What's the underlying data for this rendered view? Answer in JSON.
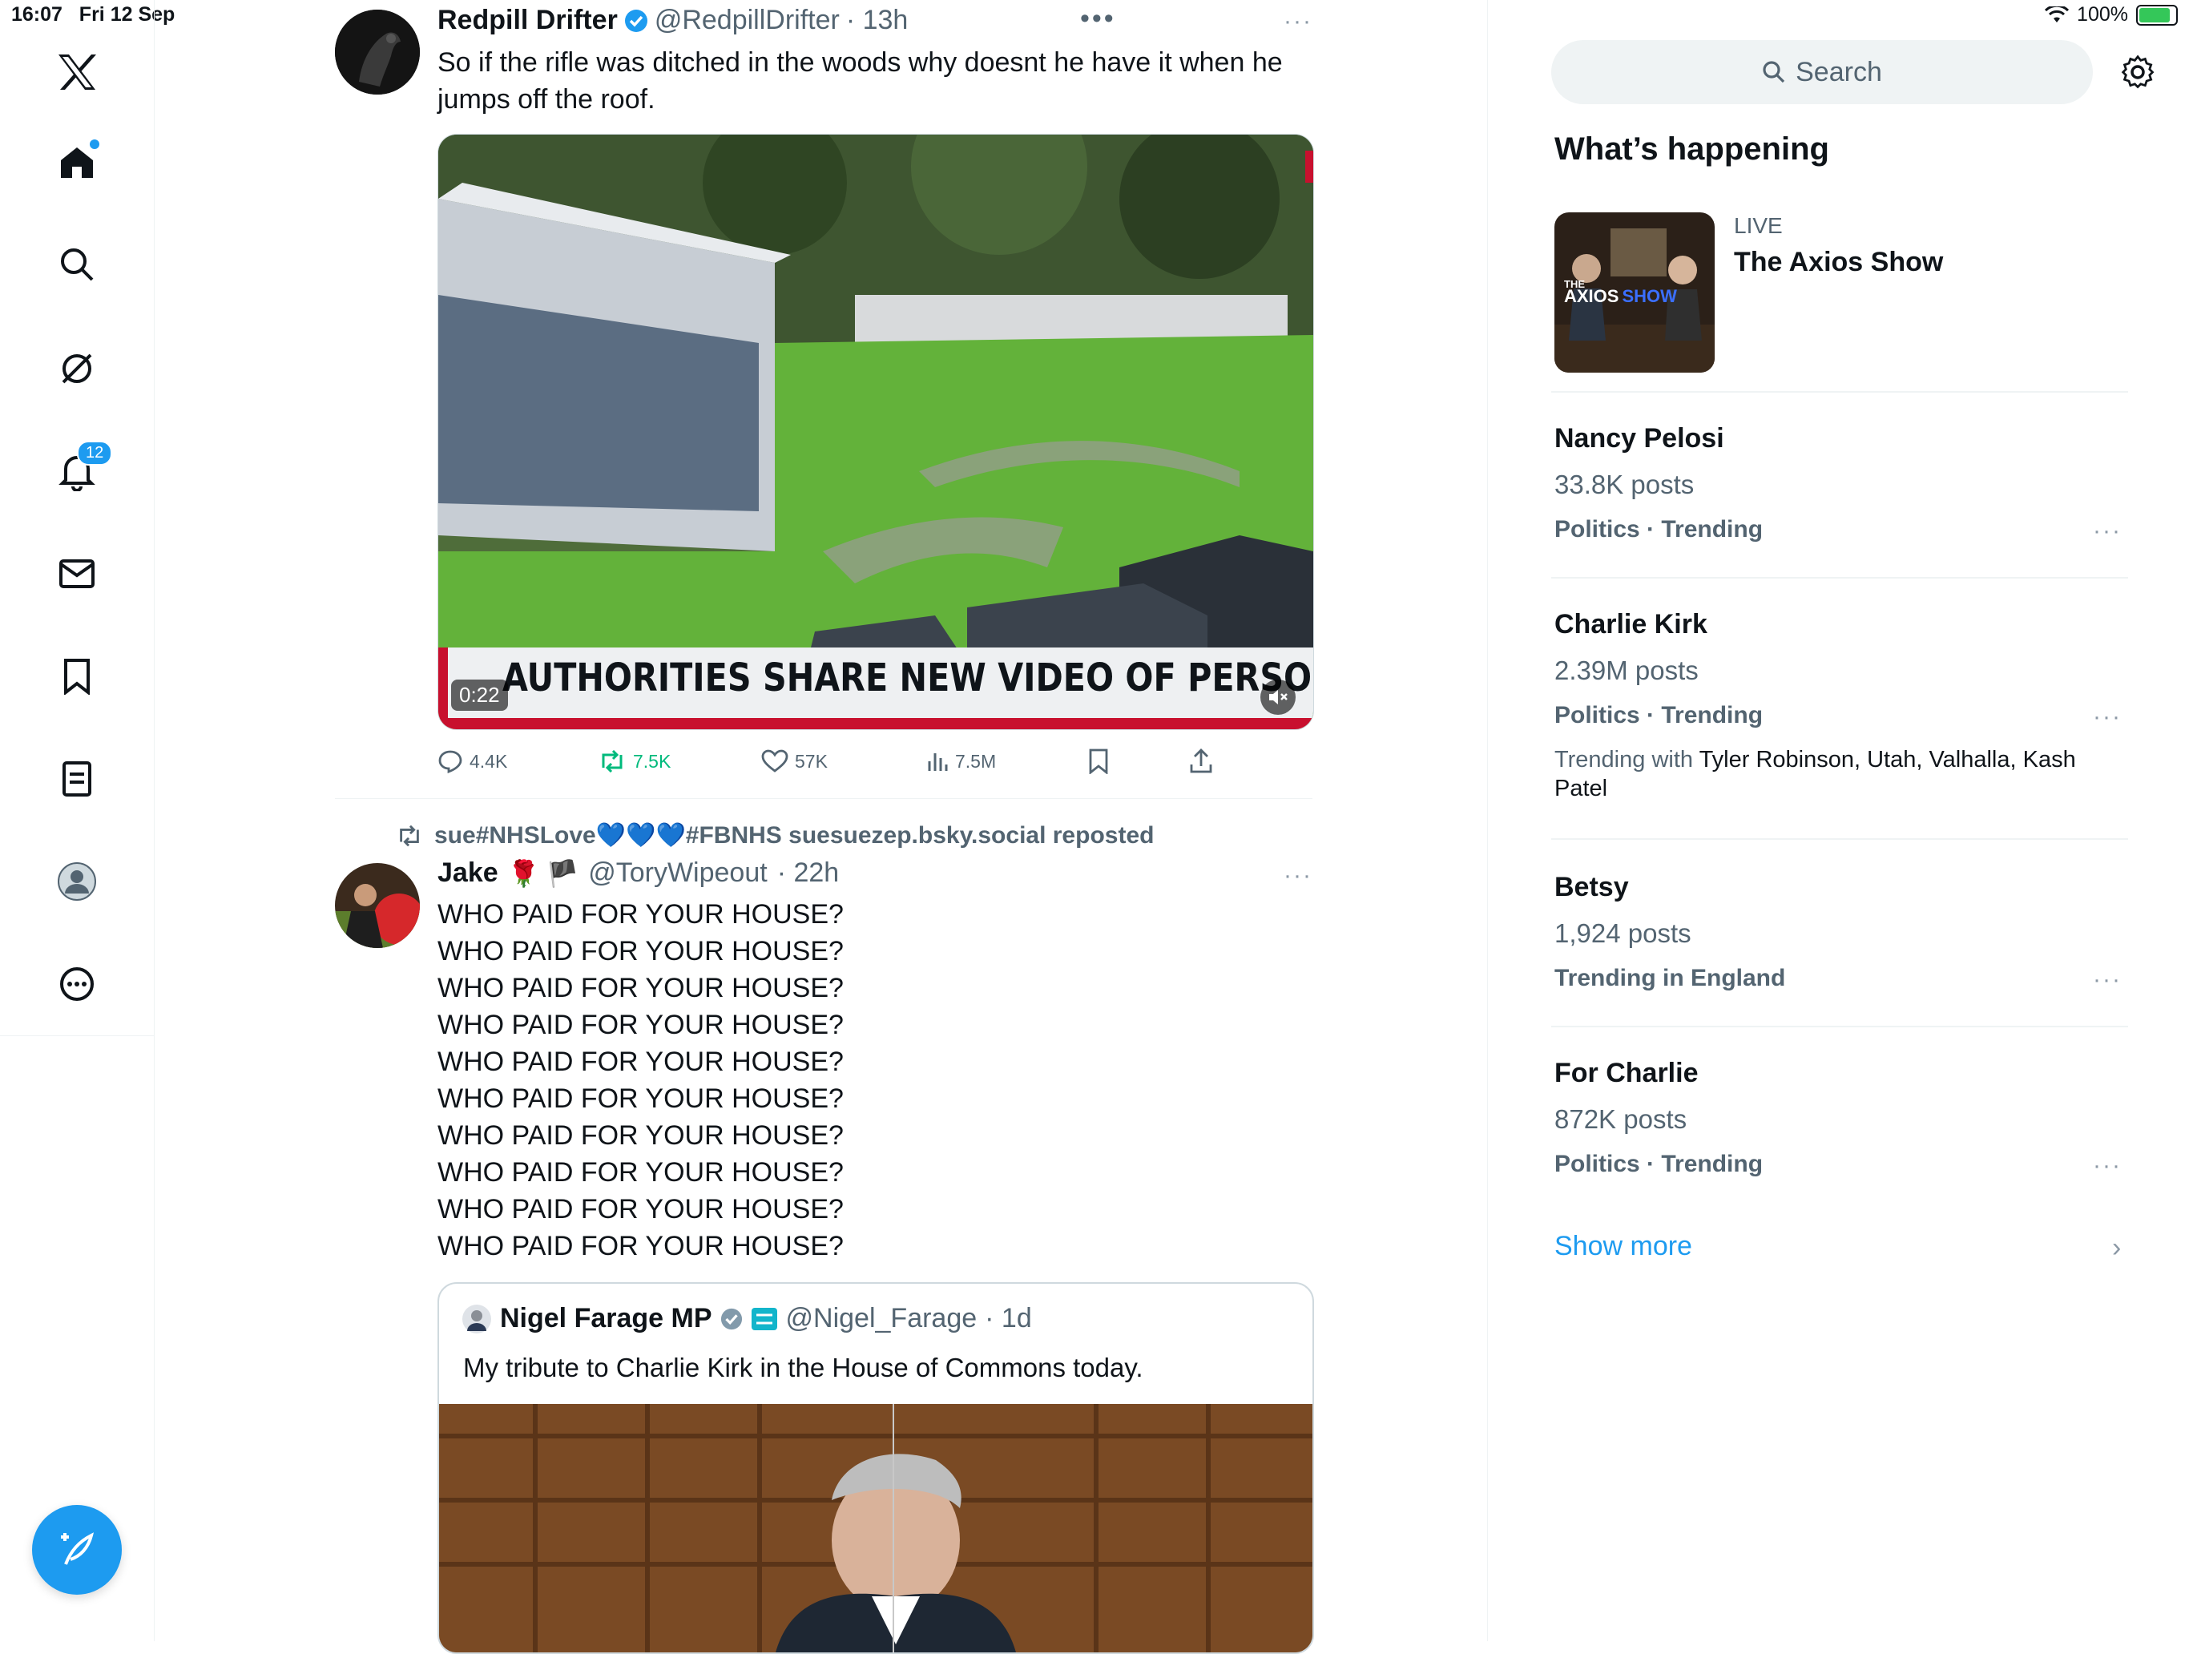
{
  "status_bar": {
    "time": "16:07",
    "date": "Fri 12 Sep",
    "battery": "100%"
  },
  "nav": {
    "notifications_badge": "12"
  },
  "tweets": [
    {
      "name": "Redpill Drifter",
      "handle": "@RedpillDrifter",
      "time": "· 13h",
      "text": "So if the rifle was ditched in the woods why doesnt he have it when he jumps off the roof.",
      "video": {
        "duration": "0:22",
        "caption": "AUTHORITIES SHARE NEW VIDEO OF PERSON OF IN"
      },
      "stats": {
        "replies": "4.4K",
        "reposts": "7.5K",
        "likes": "57K",
        "views": "7.5M"
      }
    },
    {
      "repost_line": "sue#NHSLove💙💙💙#FBNHS suesuezep.bsky.social reposted",
      "name": "Jake",
      "name_emojis": "🌹 🏴",
      "handle": "@ToryWipeout",
      "time": "· 22h",
      "lines": [
        "WHO PAID FOR YOUR HOUSE?",
        "WHO PAID FOR YOUR HOUSE?",
        "WHO PAID FOR YOUR HOUSE?",
        "WHO PAID FOR YOUR HOUSE?",
        "WHO PAID FOR YOUR HOUSE?",
        "WHO PAID FOR YOUR HOUSE?",
        "WHO PAID FOR YOUR HOUSE?",
        "WHO PAID FOR YOUR HOUSE?",
        "WHO PAID FOR YOUR HOUSE?",
        "WHO PAID FOR YOUR HOUSE?"
      ],
      "quote": {
        "name": "Nigel Farage MP",
        "handle": "@Nigel_Farage",
        "time": "· 1d",
        "text": "My tribute to Charlie Kirk in the House of Commons today."
      }
    }
  ],
  "right": {
    "search_placeholder": "Search",
    "section_title": "What’s happening",
    "live": {
      "label": "LIVE",
      "title": "The Axios Show",
      "thumb_logo_small": "THE",
      "thumb_logo": "AXIOS",
      "thumb_logo_accent": "SHOW"
    },
    "trends": [
      {
        "title": "Nancy Pelosi",
        "count": "33.8K posts",
        "category": "Politics · Trending"
      },
      {
        "title": "Charlie Kirk",
        "count": "2.39M posts",
        "category": "Politics · Trending",
        "with_label": "Trending with",
        "with_items": "Tyler Robinson, Utah, Valhalla, Kash",
        "with_items_2": "Patel"
      },
      {
        "title": "Betsy",
        "count": "1,924 posts",
        "category": "Trending in England"
      },
      {
        "title": "For Charlie",
        "count": "872K posts",
        "category": "Politics · Trending"
      }
    ],
    "show_more": "Show more"
  },
  "colors": {
    "accent": "#1d9bf0",
    "repost_green": "#00ba7c",
    "secondary_text": "#536471"
  }
}
